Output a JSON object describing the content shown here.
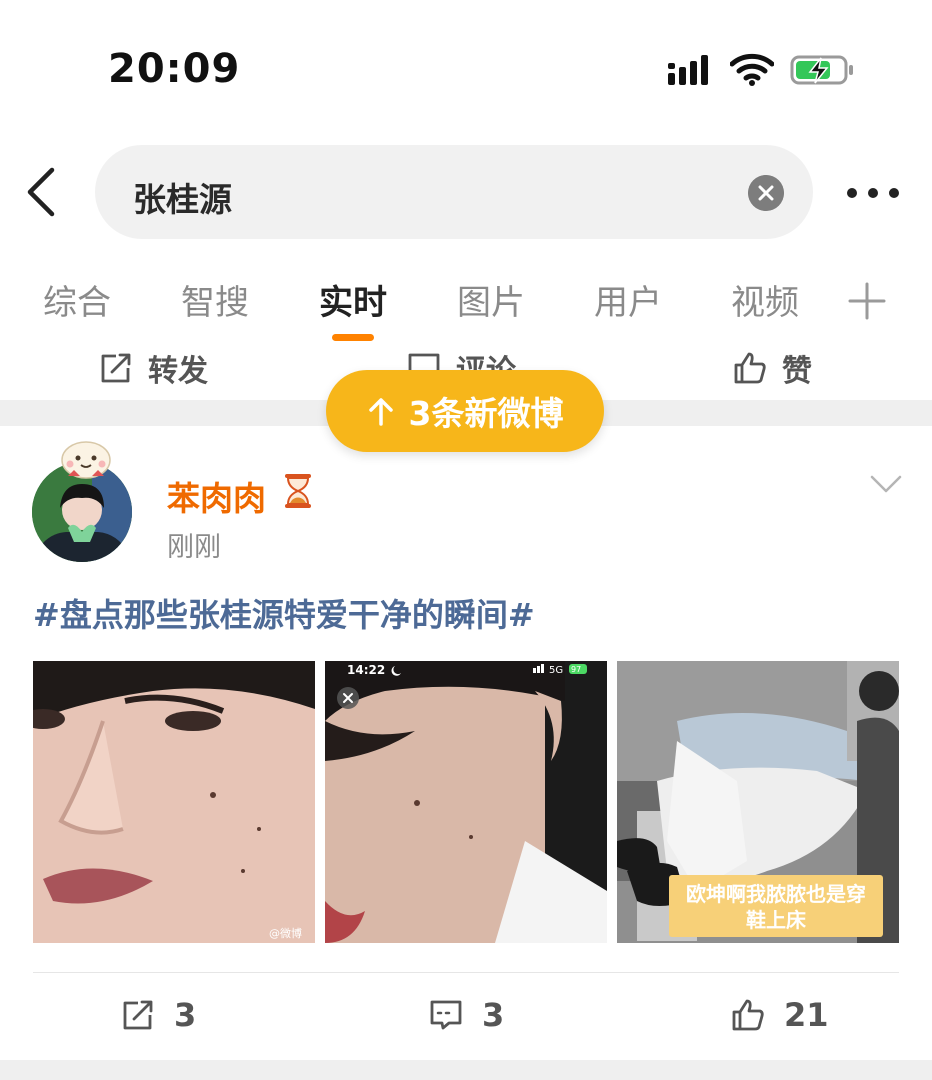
{
  "status_bar": {
    "time": "20:09"
  },
  "header": {
    "search_query": "张桂源"
  },
  "tabs": [
    {
      "label": "综合"
    },
    {
      "label": "智搜"
    },
    {
      "label": "实时"
    },
    {
      "label": "图片"
    },
    {
      "label": "用户"
    },
    {
      "label": "视频"
    }
  ],
  "previous_post_actions": {
    "repost_label": "转发",
    "comment_label": "评论",
    "like_label": "赞"
  },
  "new_posts_pill": {
    "label": "3条新微博"
  },
  "post": {
    "author": "苯肉肉",
    "time": "刚刚",
    "text": "#盘点那些张桂源特爱干净的瞬间#",
    "photos": [
      {
        "watermark": "@微博"
      },
      {
        "overlay_time": "14:22",
        "overlay_network": "5G",
        "overlay_battery": "97"
      },
      {
        "caption_line1": "欧坤啊我脓脓也是穿",
        "caption_line2": "鞋上床"
      }
    ],
    "repost_count": "3",
    "comment_count": "3",
    "like_count": "21"
  },
  "colors": {
    "accent_orange": "#ff8200",
    "author_orange": "#ef6a00",
    "pill_yellow": "#f7b61a",
    "topic_blue": "#4d6a96"
  }
}
